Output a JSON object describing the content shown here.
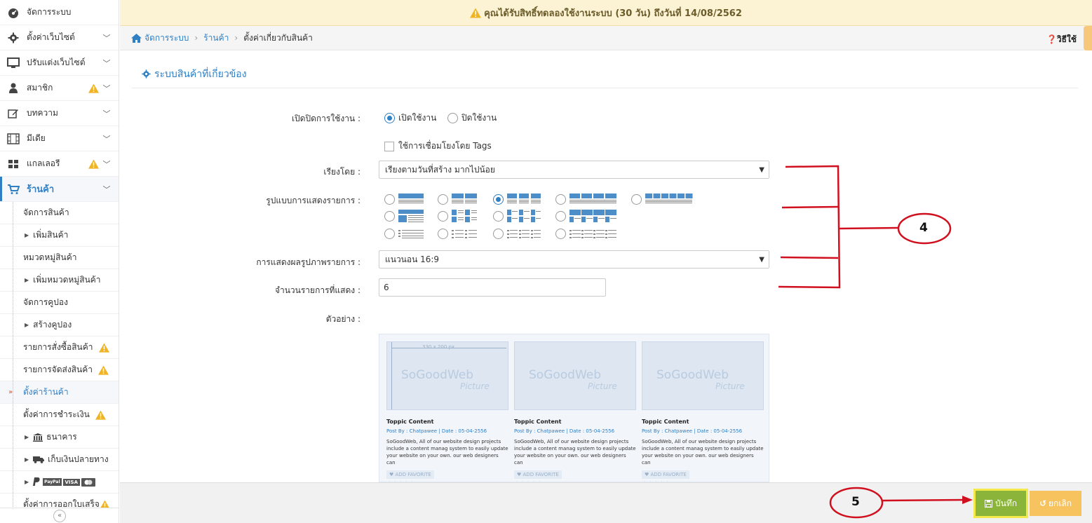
{
  "sidebar": {
    "items": [
      {
        "label": "จัดการระบบ",
        "icon": "dashboard-icon",
        "chevron": false,
        "warn": false
      },
      {
        "label": "ตั้งค่าเว็บไซต์",
        "icon": "gear-icon",
        "chevron": true,
        "warn": false
      },
      {
        "label": "ปรับแต่งเว็บไซต์",
        "icon": "monitor-icon",
        "chevron": true,
        "warn": false
      },
      {
        "label": "สมาชิก",
        "icon": "user-icon",
        "chevron": true,
        "warn": true
      },
      {
        "label": "บทความ",
        "icon": "edit-icon",
        "chevron": true,
        "warn": false
      },
      {
        "label": "มีเดีย",
        "icon": "film-icon",
        "chevron": true,
        "warn": false
      },
      {
        "label": "แกลเลอรี",
        "icon": "grid-icon",
        "chevron": true,
        "warn": true
      },
      {
        "label": "ร้านค้า",
        "icon": "cart-icon",
        "chevron": true,
        "warn": false
      }
    ],
    "shop_sub": [
      {
        "label": "จัดการสินค้า"
      },
      {
        "label": "เพิ่มสินค้า"
      },
      {
        "label": "หมวดหมู่สินค้า"
      },
      {
        "label": "เพิ่มหมวดหมู่สินค้า"
      },
      {
        "label": "จัดการคูปอง"
      },
      {
        "label": "สร้างคูปอง"
      },
      {
        "label": "รายการสั่งซื้อสินค้า"
      },
      {
        "label": "รายการจัดส่งสินค้า"
      },
      {
        "label": "ตั้งค่าร้านค้า"
      },
      {
        "label": "ตั้งค่าการชำระเงิน"
      },
      {
        "label": "ธนาคาร"
      },
      {
        "label": "เก็บเงินปลายทาง"
      },
      {
        "label": "ตั้งค่าการออกใบเสร็จ"
      }
    ],
    "payment_badges": [
      "PayPal",
      "VISA"
    ]
  },
  "banner": {
    "text": "คุณได้รับสิทธิ์ทดลองใช้งานระบบ (30 วัน) ถึงวันที่ 14/08/2562"
  },
  "breadcrumb": {
    "home": "จัดการระบบ",
    "shop": "ร้านค้า",
    "current": "ตั้งค่าเกี่ยวกับสินค้า",
    "help": "วิธีใช้"
  },
  "panel": {
    "title": "ระบบสินค้าที่เกี่ยวข้อง"
  },
  "form": {
    "enable_label": "เปิดปิดการใช้งาน :",
    "enable_on": "เปิดใช้งาน",
    "enable_off": "ปิดใช้งาน",
    "tags_label": "ใช้การเชื่อมโยงโดย Tags",
    "sort_label": "เรียงโดย :",
    "sort_value": "เรียงตามวันที่สร้าง มากไปน้อย",
    "layout_label": "รูปแบบการแสดงรายการ :",
    "image_label": "การแสดงผลรูปภาพรายการ :",
    "image_value": "แนวนอน 16:9",
    "count_label": "จำนวนรายการที่แสดง :",
    "count_value": "6",
    "example_label": "ตัวอย่าง :"
  },
  "preview": {
    "dimension": "330 x 200 px",
    "watermark": "SoGoodWeb",
    "watermark_sub": "Picture",
    "cards": [
      {
        "title": "Toppic Content",
        "meta": "Post By : Chatpawee  |  Date : 05-04-2556",
        "desc": "SoGoodWeb, All of our website design projects include a content manag system to easily update your website on your own. our web designers can",
        "fav": "ADD FAVORITE"
      },
      {
        "title": "Toppic Content",
        "meta": "Post By : Chatpawee  |  Date : 05-04-2556",
        "desc": "SoGoodWeb, All of our website design projects include a content manag system to easily update your website on your own. our web designers can",
        "fav": "ADD FAVORITE"
      },
      {
        "title": "Toppic Content",
        "meta": "Post By : Chatpawee  |  Date : 05-04-2556",
        "desc": "SoGoodWeb, All of our website design projects include a content manag system to easily update your website on your own. our web designers can",
        "fav": "ADD FAVORITE"
      }
    ]
  },
  "buttons": {
    "save": "บันทึก",
    "cancel": "ยกเลิก"
  },
  "annotations": {
    "four": "4",
    "five": "5"
  },
  "colors": {
    "accent": "#2f7fc4",
    "save": "#8ab53a",
    "cancel": "#f7c35f",
    "annotation": "#d0101e"
  }
}
